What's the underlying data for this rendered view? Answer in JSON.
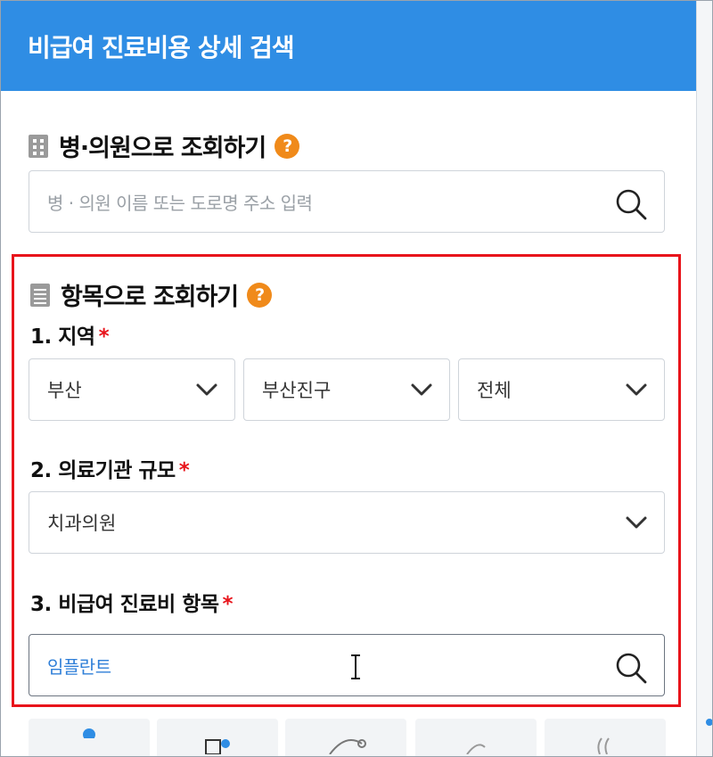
{
  "header": {
    "title": "비급여 진료비용 상세 검색"
  },
  "hospital_search": {
    "title": "병·의원으로 조회하기",
    "help": "?",
    "placeholder": "병 · 의원 이름 또는 도로명 주소 입력"
  },
  "item_search": {
    "title": "항목으로 조회하기",
    "help": "?",
    "region": {
      "label": "1. 지역",
      "required": "*",
      "province": "부산",
      "district": "부산진구",
      "dong": "전체"
    },
    "scale": {
      "label": "2. 의료기관 규모",
      "required": "*",
      "value": "치과의원"
    },
    "item": {
      "label": "3. 비급여 진료비 항목",
      "required": "*",
      "value": "임플란트"
    }
  },
  "colors": {
    "header_bg": "#2f8de4",
    "help_badge": "#f08a1a",
    "required": "#e8141b",
    "highlight_border": "#e8141b",
    "input_value": "#2f7fd8"
  },
  "icons": {
    "hospital_section": "building-icon",
    "item_section": "list-icon",
    "search": "search-icon",
    "dropdown": "chevron-down-icon",
    "cursor": "text-cursor-icon"
  }
}
